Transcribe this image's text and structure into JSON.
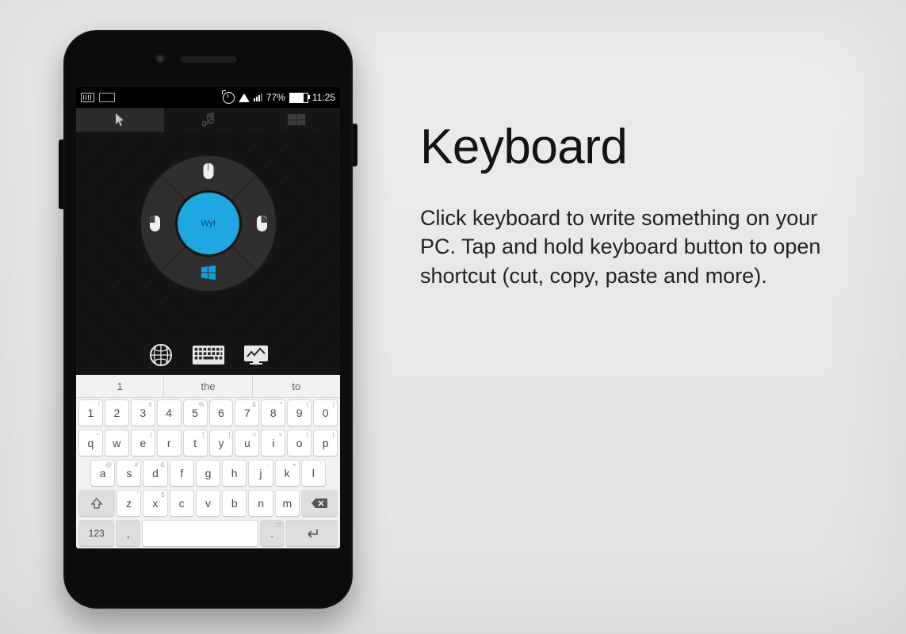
{
  "marketing": {
    "heading": "Keyboard",
    "body": "Click keyboard to write some­thing on your PC.  Tap and hold keyboard button to open short­cut (cut, copy, paste and more)."
  },
  "statusbar": {
    "battery_pct": "77%",
    "time": "11:25"
  },
  "radial": {
    "center_label": "Wył"
  },
  "suggestions": [
    "1",
    "the",
    "to"
  ],
  "keyboard": {
    "row_num": [
      "1",
      "2",
      "3",
      "4",
      "5",
      "6",
      "7",
      "8",
      "9",
      "0"
    ],
    "row_num_sub": [
      "!",
      "",
      "#",
      "",
      "%",
      "",
      "&",
      "*",
      "(",
      ")"
    ],
    "row1": [
      "q",
      "w",
      "e",
      "r",
      "t",
      "y",
      "u",
      "i",
      "o",
      "p"
    ],
    "row1_sub": [
      "~",
      "`",
      "|",
      "",
      "[",
      "]",
      "<",
      ">",
      "{",
      "}"
    ],
    "row2": [
      "a",
      "s",
      "d",
      "f",
      "g",
      "h",
      "j",
      "k",
      "l"
    ],
    "row2_sub": [
      "@",
      "#",
      "&",
      "",
      "",
      "",
      "-",
      "+",
      "\""
    ],
    "row3": [
      "z",
      "x",
      "c",
      "v",
      "b",
      "n",
      "m"
    ],
    "row3_sub": [
      "'",
      "$",
      "",
      "",
      "",
      "",
      ""
    ],
    "sym_label": "123",
    "comma": ",",
    "period": ".",
    "period_sub": ".!?"
  }
}
